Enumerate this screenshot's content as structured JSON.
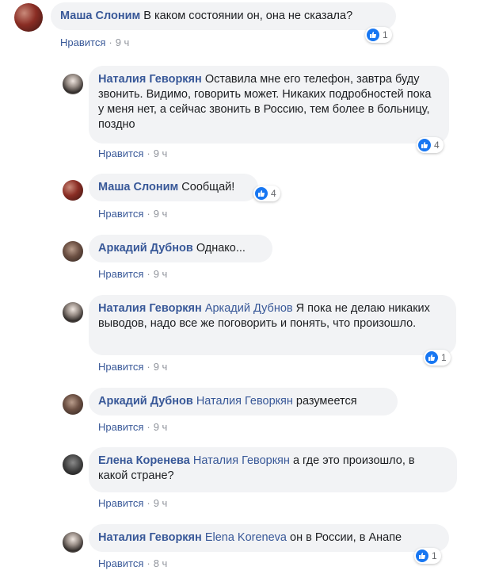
{
  "comments": [
    {
      "author": "Маша Слоним",
      "mention": "",
      "text": "В каком состоянии он, она не сказала?",
      "like": "Нравится",
      "time": "9 ч",
      "reactions": "1"
    },
    {
      "author": "Наталия Геворкян",
      "mention": "",
      "text": "Оставила мне его телефон, завтра буду звонить. Видимо, говорить может. Никаких подробностей пока у меня нет, а сейчас звонить в Россию, тем более в больницу, поздно",
      "like": "Нравится",
      "time": "9 ч",
      "reactions": "4"
    },
    {
      "author": "Маша Слоним",
      "mention": "",
      "text": "Сообщай!",
      "like": "Нравится",
      "time": "9 ч",
      "reactions": "4"
    },
    {
      "author": "Аркадий Дубнов",
      "mention": "",
      "text": "Однако...",
      "like": "Нравится",
      "time": "9 ч",
      "reactions": ""
    },
    {
      "author": "Наталия Геворкян",
      "mention": "Аркадий Дубнов",
      "text": "Я пока не делаю никаких выводов, надо все же поговорить и понять, что произошло.",
      "like": "Нравится",
      "time": "9 ч",
      "reactions": "1"
    },
    {
      "author": "Аркадий Дубнов",
      "mention": "Наталия Геворкян",
      "text": "разумеется",
      "like": "Нравится",
      "time": "9 ч",
      "reactions": ""
    },
    {
      "author": "Елена Коренева",
      "mention": "Наталия Геворкян",
      "text": "а где это произошло, в какой стране?",
      "like": "Нравится",
      "time": "9 ч",
      "reactions": ""
    },
    {
      "author": "Наталия Геворкян",
      "mention": "Elena Koreneva",
      "text": "он в России, в Анапе",
      "like": "Нравится",
      "time": "8 ч",
      "reactions": "1"
    }
  ],
  "colors": {
    "link": "#385898",
    "bubble": "#f2f3f5",
    "like_badge": "#1877f2",
    "meta": "#90949c"
  },
  "icons": {
    "reaction": "thumbs-up-icon"
  }
}
